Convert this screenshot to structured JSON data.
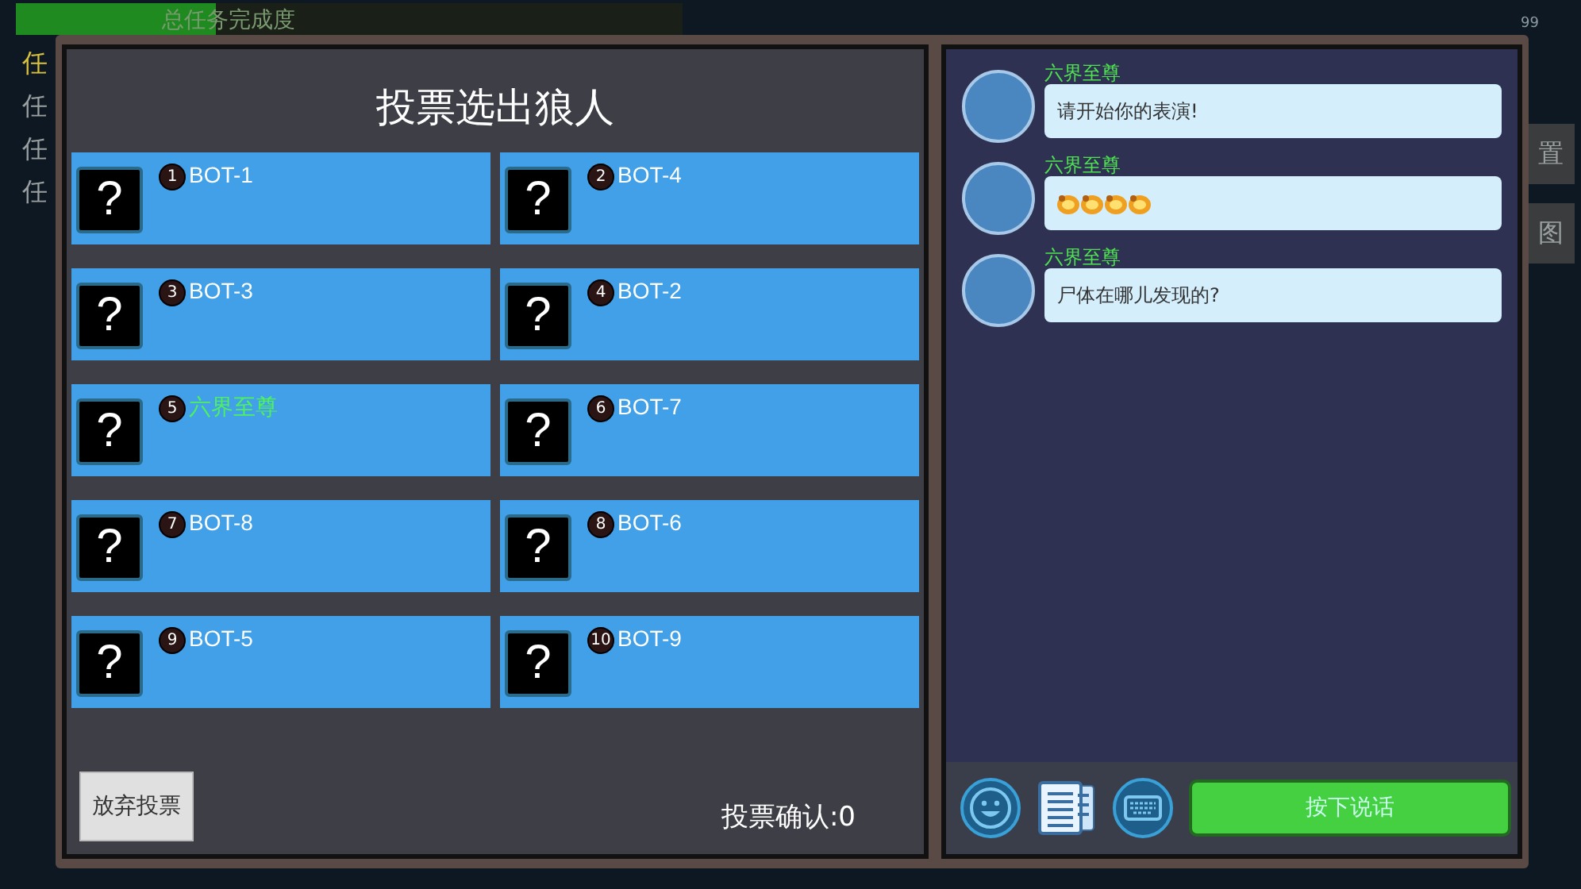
{
  "background": {
    "task_bar": {
      "label": "总任务完成度",
      "level": 0.3
    },
    "task_items": [
      {
        "label": "任",
        "selected": true
      },
      {
        "label": "任",
        "selected": false
      },
      {
        "label": "任",
        "selected": false
      },
      {
        "label": "任",
        "selected": false
      }
    ],
    "side_tabs": [
      "置",
      "图"
    ],
    "signal_text": "99"
  },
  "vote": {
    "title": "投票选出狼人",
    "players": [
      {
        "number": "1",
        "name": "BOT-1",
        "self": false
      },
      {
        "number": "2",
        "name": "BOT-4",
        "self": false
      },
      {
        "number": "3",
        "name": "BOT-3",
        "self": false
      },
      {
        "number": "4",
        "name": "BOT-2",
        "self": false
      },
      {
        "number": "5",
        "name": "六界至尊",
        "self": true
      },
      {
        "number": "6",
        "name": "BOT-7",
        "self": false
      },
      {
        "number": "7",
        "name": "BOT-8",
        "self": false
      },
      {
        "number": "8",
        "name": "BOT-6",
        "self": false
      },
      {
        "number": "9",
        "name": "BOT-5",
        "self": false
      },
      {
        "number": "10",
        "name": "BOT-9",
        "self": false
      }
    ],
    "avatar_text": "?",
    "abstain_button": "放弃投票",
    "confirm_count": "投票确认:0"
  },
  "chat": {
    "messages": [
      {
        "sender": "六界至尊",
        "kind": "text",
        "text": "请开始你的表演!"
      },
      {
        "sender": "六界至尊",
        "kind": "emoji"
      },
      {
        "sender": "六界至尊",
        "kind": "text",
        "text": "尸体在哪儿发现的?"
      }
    ],
    "talk_button": "按下说话"
  }
}
